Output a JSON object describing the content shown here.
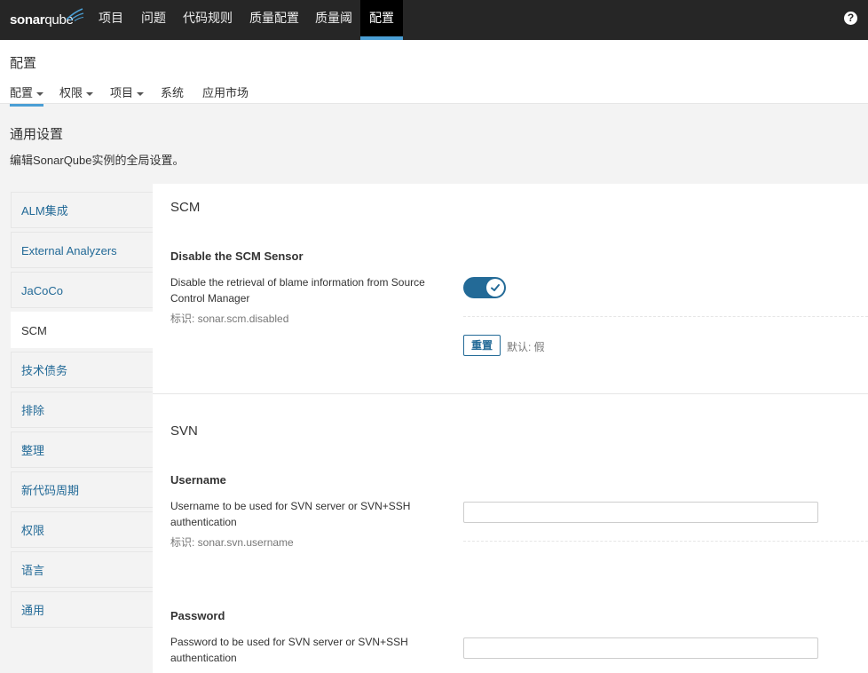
{
  "topbar": {
    "logo": {
      "text_bold": "sonar",
      "text_light": "qube"
    },
    "nav_items": [
      "项目",
      "问题",
      "代码规则",
      "质量配置",
      "质量阈",
      "配置"
    ],
    "active_nav": "配置",
    "help_icon": "?"
  },
  "page": {
    "title": "配置",
    "sub_nav": [
      {
        "label": "配置",
        "dropdown": true,
        "active": true
      },
      {
        "label": "权限",
        "dropdown": true
      },
      {
        "label": "项目",
        "dropdown": true
      },
      {
        "label": "系统"
      },
      {
        "label": "应用市场"
      }
    ]
  },
  "section": {
    "title": "通用设置",
    "description": "编辑SonarQube实例的全局设置。"
  },
  "categories": [
    "ALM集成",
    "External Analyzers",
    "JaCoCo",
    "SCM",
    "技术债务",
    "排除",
    "整理",
    "新代码周期",
    "权限",
    "语言",
    "通用"
  ],
  "selected_category": "SCM",
  "groups": {
    "scm": {
      "title": "SCM",
      "setting": {
        "name": "Disable the SCM Sensor",
        "description": "Disable the retrieval of blame information from Source Control Manager",
        "key": "标识: sonar.scm.disabled",
        "value": true,
        "reset_label": "重置",
        "default_text": "默认: 假"
      }
    },
    "svn": {
      "title": "SVN",
      "username": {
        "name": "Username",
        "description": "Username to be used for SVN server or SVN+SSH authentication",
        "key": "标识: sonar.svn.username",
        "value": ""
      },
      "password": {
        "name": "Password",
        "description": "Password to be used for SVN server or SVN+SSH authentication",
        "value": ""
      }
    }
  },
  "colors": {
    "topbar_bg": "#262626",
    "accent_blue": "#236a97",
    "active_underline": "#4b9fd5"
  }
}
